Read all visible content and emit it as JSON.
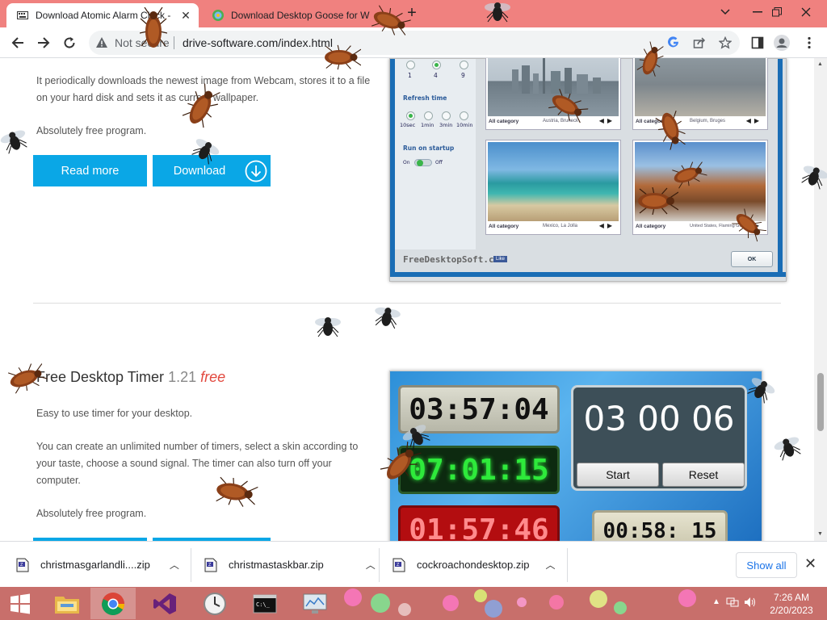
{
  "browser": {
    "tabs": [
      {
        "title": "Download Atomic Alarm Clock -",
        "active": true
      },
      {
        "title": "Download Desktop Goose for W",
        "active": false
      }
    ],
    "new_tab_label": "+",
    "address": {
      "security_label": "Not secure",
      "url": "drive-software.com/index.html"
    }
  },
  "page": {
    "section1": {
      "para1": "It periodically downloads the newest image from Webcam, stores it to a file on your hard disk and sets it as current wallpaper.",
      "para2": "Absolutely free program.",
      "read_more": "Read more",
      "download": "Download"
    },
    "screenshot1": {
      "grid_opts": [
        "1",
        "4",
        "9"
      ],
      "refresh_title": "Refresh time",
      "refresh_opts": [
        "10sec",
        "1min",
        "3min",
        "10min"
      ],
      "startup_title": "Run on startup",
      "toggle_on": "On",
      "toggle_off": "Off",
      "category": "All category",
      "thumb_locations": [
        "Austria, Bruneck",
        "Belgium, Bruges",
        "Mexico, La Jolla",
        "United States, Flaming Gorge"
      ],
      "brand": "FreeDesktopSoft.com",
      "like": "Like",
      "ok": "OK"
    },
    "section2": {
      "title": "Free Desktop Timer",
      "version": "1.21",
      "free": "free",
      "para1": "Easy to use timer for your desktop.",
      "para2": "You can create an unlimited number of timers, select a skin according to your taste, choose a sound signal. The timer can also turn off your computer.",
      "para3": "Absolutely free program."
    },
    "screenshot2": {
      "timer1": "03:57:04",
      "timer2": "07:01:15",
      "timer3": "01:57:46",
      "timer4": "00:58: 15",
      "big_timer": "03 00 06",
      "start": "Start",
      "reset": "Reset"
    }
  },
  "downloads": {
    "items": [
      "christmasgarlandli....zip",
      "christmastaskbar.zip",
      "cockroachondesktop.zip"
    ],
    "show_all": "Show all"
  },
  "taskbar": {
    "time": "7:26 AM",
    "date": "2/20/2023",
    "apps": [
      "start",
      "file-explorer",
      "chrome",
      "visual-studio",
      "clock",
      "command-prompt",
      "remote-desktop"
    ]
  },
  "colors": {
    "tabstrip": "#f0817f",
    "button_blue": "#0aa7e6",
    "free_red": "#e2493f",
    "taskbar": "#c86f6b"
  }
}
